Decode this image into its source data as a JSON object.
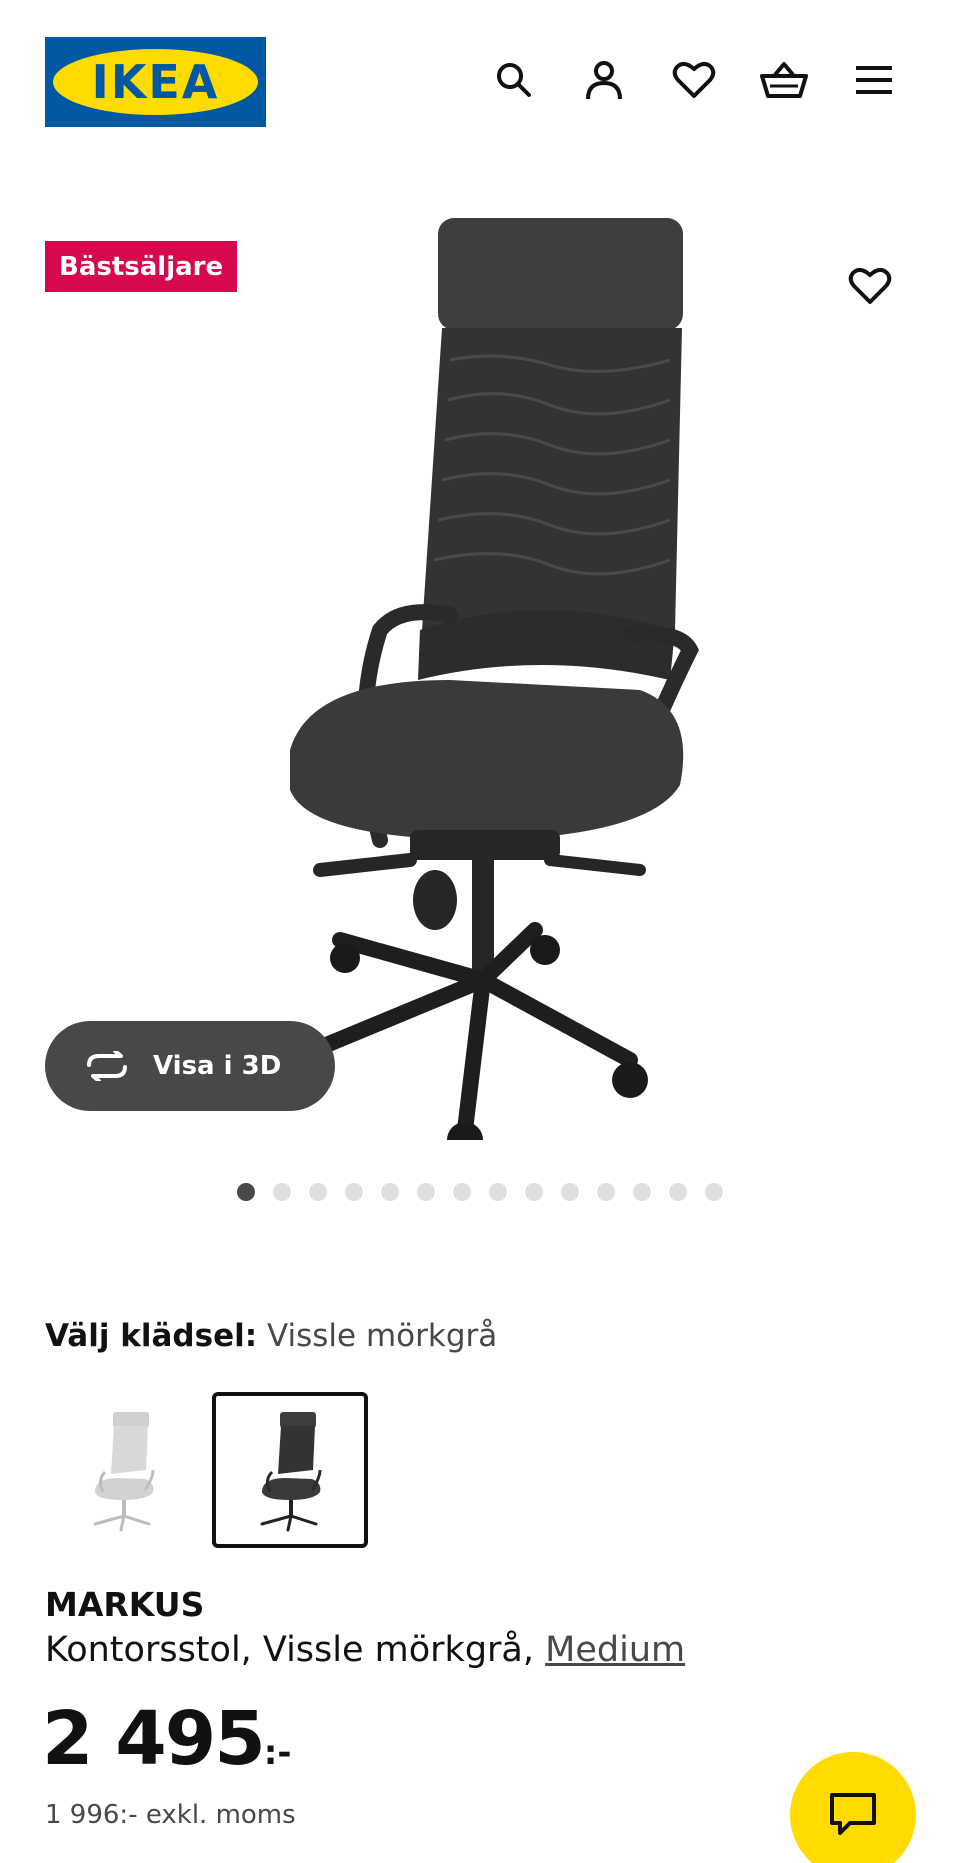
{
  "header": {
    "logo_text": "IKEA",
    "icons": [
      "search-icon",
      "account-icon",
      "heart-icon",
      "basket-icon",
      "menu-icon"
    ]
  },
  "hero": {
    "badge": "Bästsäljare",
    "view_3d_label": "Visa i 3D",
    "image_count": 14,
    "active_image": 1
  },
  "variant": {
    "label": "Välj klädsel:",
    "selected": "Vissle mörkgrå",
    "options": [
      "Vissle ljusgrå",
      "Vissle mörkgrå"
    ]
  },
  "product": {
    "name": "MARKUS",
    "description": "Kontorsstol, Vissle mörkgrå,",
    "size_link": "Medium",
    "price": "2 495",
    "price_suffix": ":-",
    "price_excl_vat": "1 996:- exkl. moms"
  },
  "colors": {
    "brand_blue": "#0058a3",
    "brand_yellow": "#ffdb00",
    "badge_red": "#d6094f",
    "dark_button": "#484848"
  }
}
